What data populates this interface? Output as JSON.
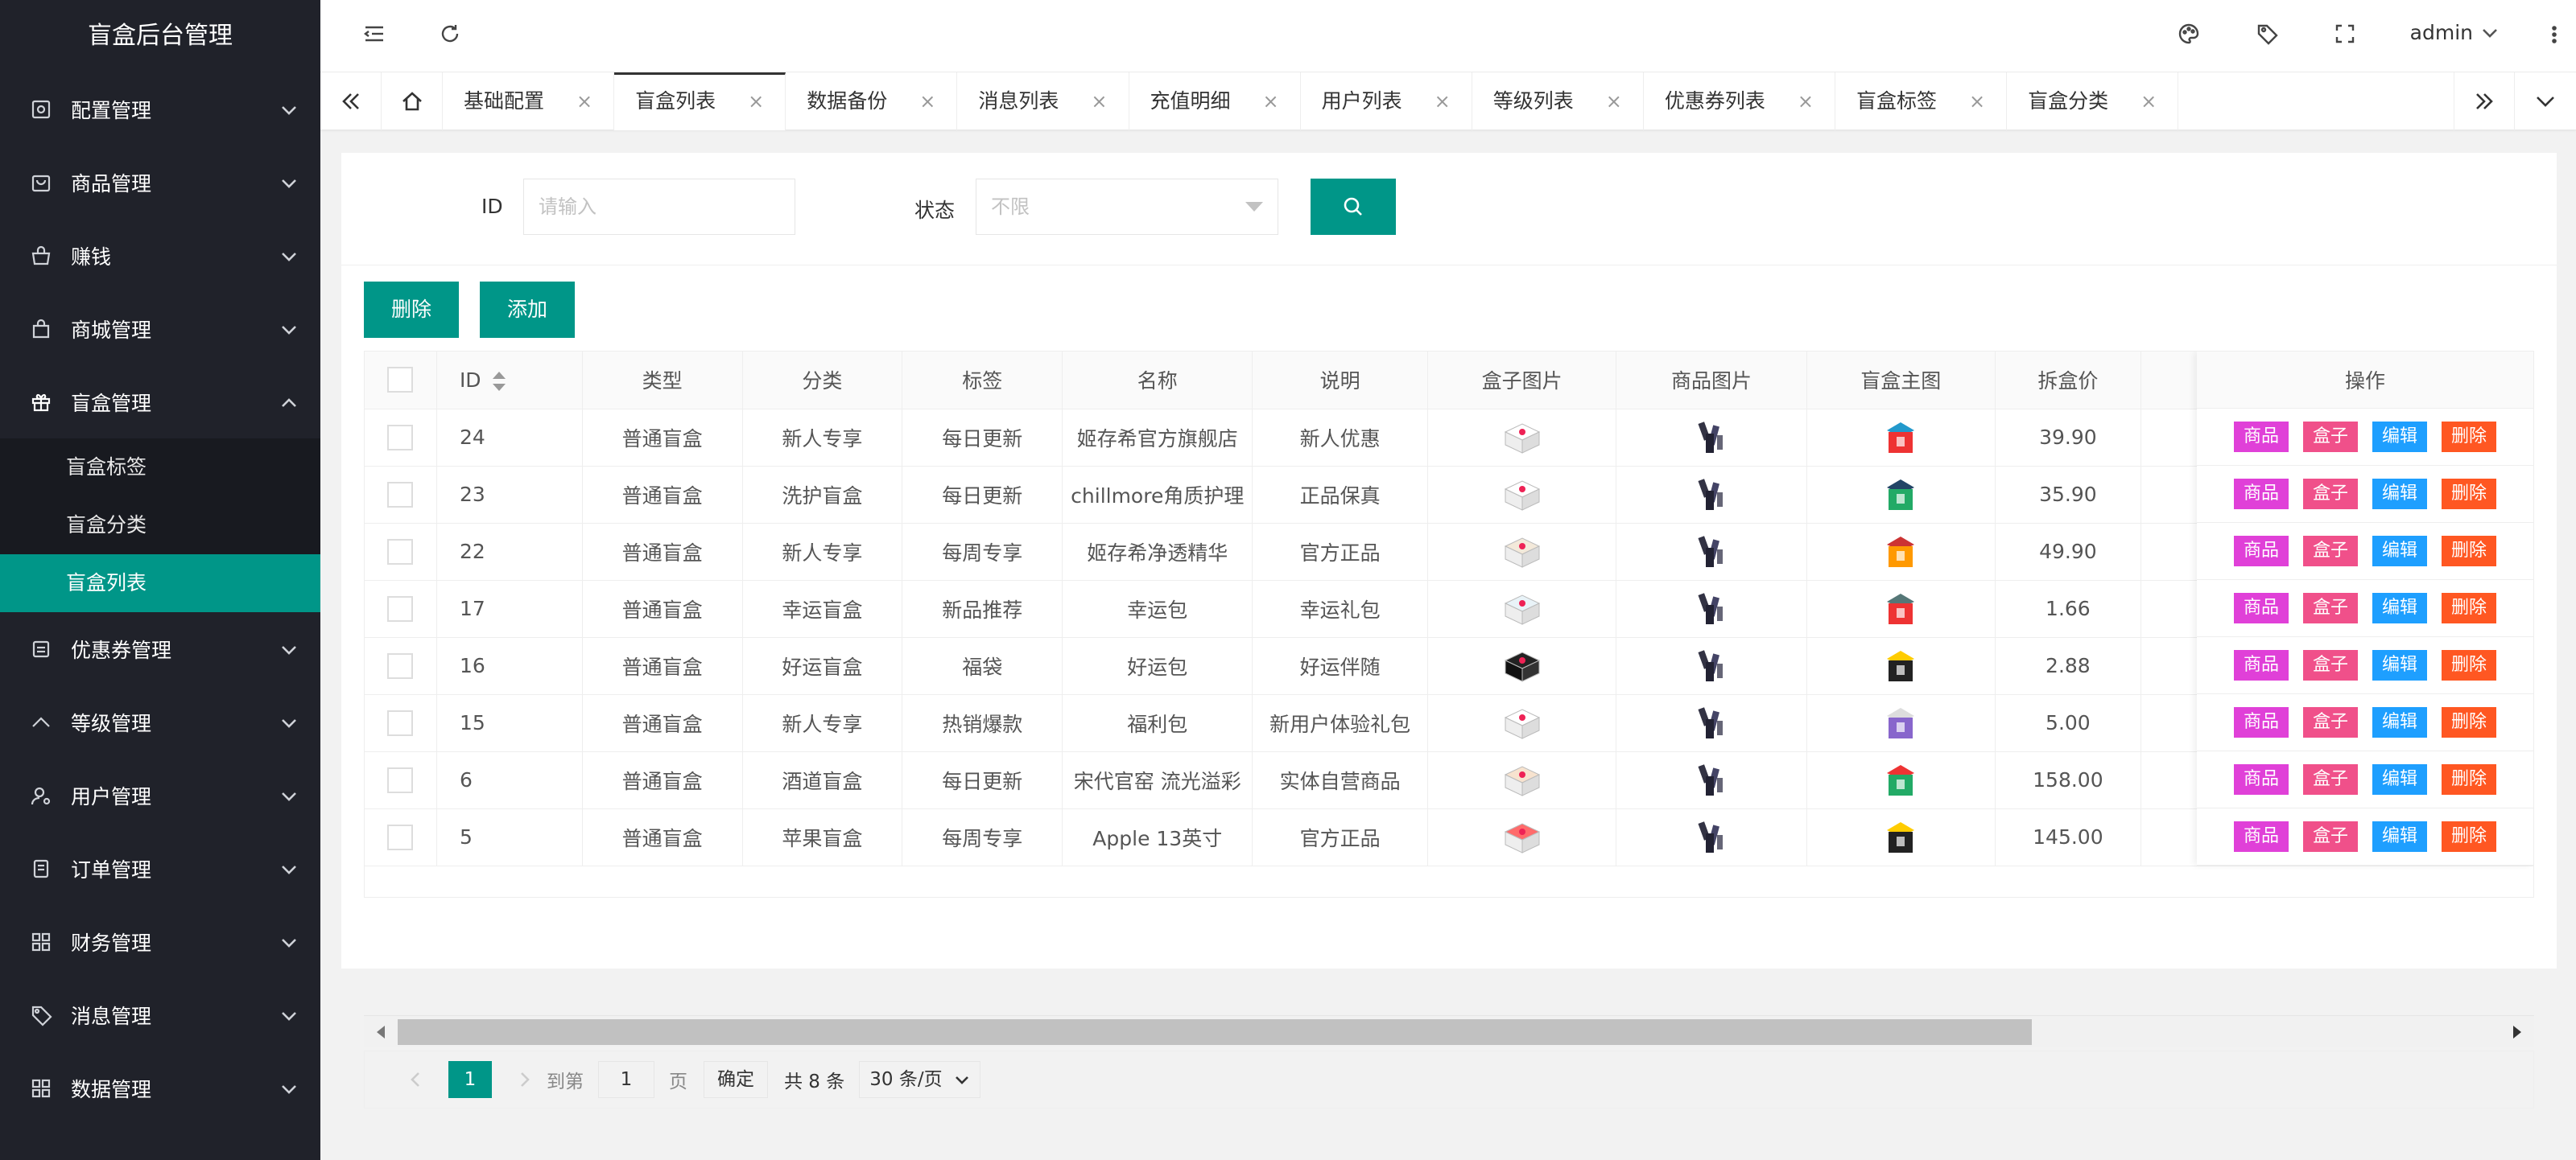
{
  "app": {
    "title": "盲盒后台管理"
  },
  "sidebar": {
    "items": [
      {
        "label": "配置管理",
        "icon": "settings-icon"
      },
      {
        "label": "商品管理",
        "icon": "bag-icon"
      },
      {
        "label": "赚钱",
        "icon": "basket-icon"
      },
      {
        "label": "商城管理",
        "icon": "store-icon"
      },
      {
        "label": "盲盒管理",
        "icon": "gift-icon",
        "open": true
      },
      {
        "label": "优惠券管理",
        "icon": "coupon-icon"
      },
      {
        "label": "等级管理",
        "icon": "level-icon"
      },
      {
        "label": "用户管理",
        "icon": "user-icon"
      },
      {
        "label": "订单管理",
        "icon": "order-icon"
      },
      {
        "label": "财务管理",
        "icon": "grid-icon"
      },
      {
        "label": "消息管理",
        "icon": "tag-icon"
      },
      {
        "label": "数据管理",
        "icon": "grid-icon"
      }
    ],
    "submenu": [
      {
        "label": "盲盒标签"
      },
      {
        "label": "盲盒分类"
      },
      {
        "label": "盲盒列表",
        "active": true
      }
    ]
  },
  "topbar": {
    "user": "admin"
  },
  "tabs": [
    {
      "label": "基础配置"
    },
    {
      "label": "盲盒列表",
      "active": true
    },
    {
      "label": "数据备份"
    },
    {
      "label": "消息列表"
    },
    {
      "label": "充值明细"
    },
    {
      "label": "用户列表"
    },
    {
      "label": "等级列表"
    },
    {
      "label": "优惠券列表"
    },
    {
      "label": "盲盒标签"
    },
    {
      "label": "盲盒分类"
    }
  ],
  "search": {
    "id_label": "ID",
    "id_placeholder": "请输入",
    "status_label": "状态",
    "status_value": "不限"
  },
  "actions": {
    "delete": "删除",
    "add": "添加"
  },
  "table": {
    "columns": [
      "ID",
      "类型",
      "分类",
      "标签",
      "名称",
      "说明",
      "盒子图片",
      "商品图片",
      "盲盒主图",
      "拆盒价"
    ],
    "ops_header": "操作",
    "ops_buttons": {
      "goods": "商品",
      "box": "盒子",
      "edit": "编辑",
      "delete": "删除"
    },
    "rows": [
      {
        "id": "24",
        "type": "普通盲盒",
        "category": "新人专享",
        "tag": "每日更新",
        "name": "姬存希官方旗舰店",
        "desc": "新人优惠",
        "price": "39.90"
      },
      {
        "id": "23",
        "type": "普通盲盒",
        "category": "洗护盲盒",
        "tag": "每日更新",
        "name": "chillmore角质护理",
        "desc": "正品保真",
        "price": "35.90"
      },
      {
        "id": "22",
        "type": "普通盲盒",
        "category": "新人专享",
        "tag": "每周专享",
        "name": "姬存希净透精华",
        "desc": "官方正品",
        "price": "49.90"
      },
      {
        "id": "17",
        "type": "普通盲盒",
        "category": "幸运盲盒",
        "tag": "新品推荐",
        "name": "幸运包",
        "desc": "幸运礼包",
        "price": "1.66"
      },
      {
        "id": "16",
        "type": "普通盲盒",
        "category": "好运盲盒",
        "tag": "福袋",
        "name": "好运包",
        "desc": "好运伴随",
        "price": "2.88"
      },
      {
        "id": "15",
        "type": "普通盲盒",
        "category": "新人专享",
        "tag": "热销爆款",
        "name": "福利包",
        "desc": "新用户体验礼包",
        "price": "5.00"
      },
      {
        "id": "6",
        "type": "普通盲盒",
        "category": "酒道盲盒",
        "tag": "每日更新",
        "name": "宋代官窑 流光溢彩",
        "desc": "实体自营商品",
        "price": "158.00"
      },
      {
        "id": "5",
        "type": "普通盲盒",
        "category": "苹果盲盒",
        "tag": "每周专享",
        "name": "Apple 13英寸",
        "desc": "官方正品",
        "price": "145.00"
      }
    ]
  },
  "pager": {
    "current": "1",
    "goto_label": "到第",
    "goto_value": "1",
    "page_unit": "页",
    "confirm": "确定",
    "total": "共 8 条",
    "page_size": "30 条/页"
  },
  "colors": {
    "primary": "#009688",
    "sidebar": "#20222a",
    "goods": "#e040d8",
    "box": "#f0508a",
    "edit": "#1e9fff",
    "delete": "#ff5722"
  }
}
